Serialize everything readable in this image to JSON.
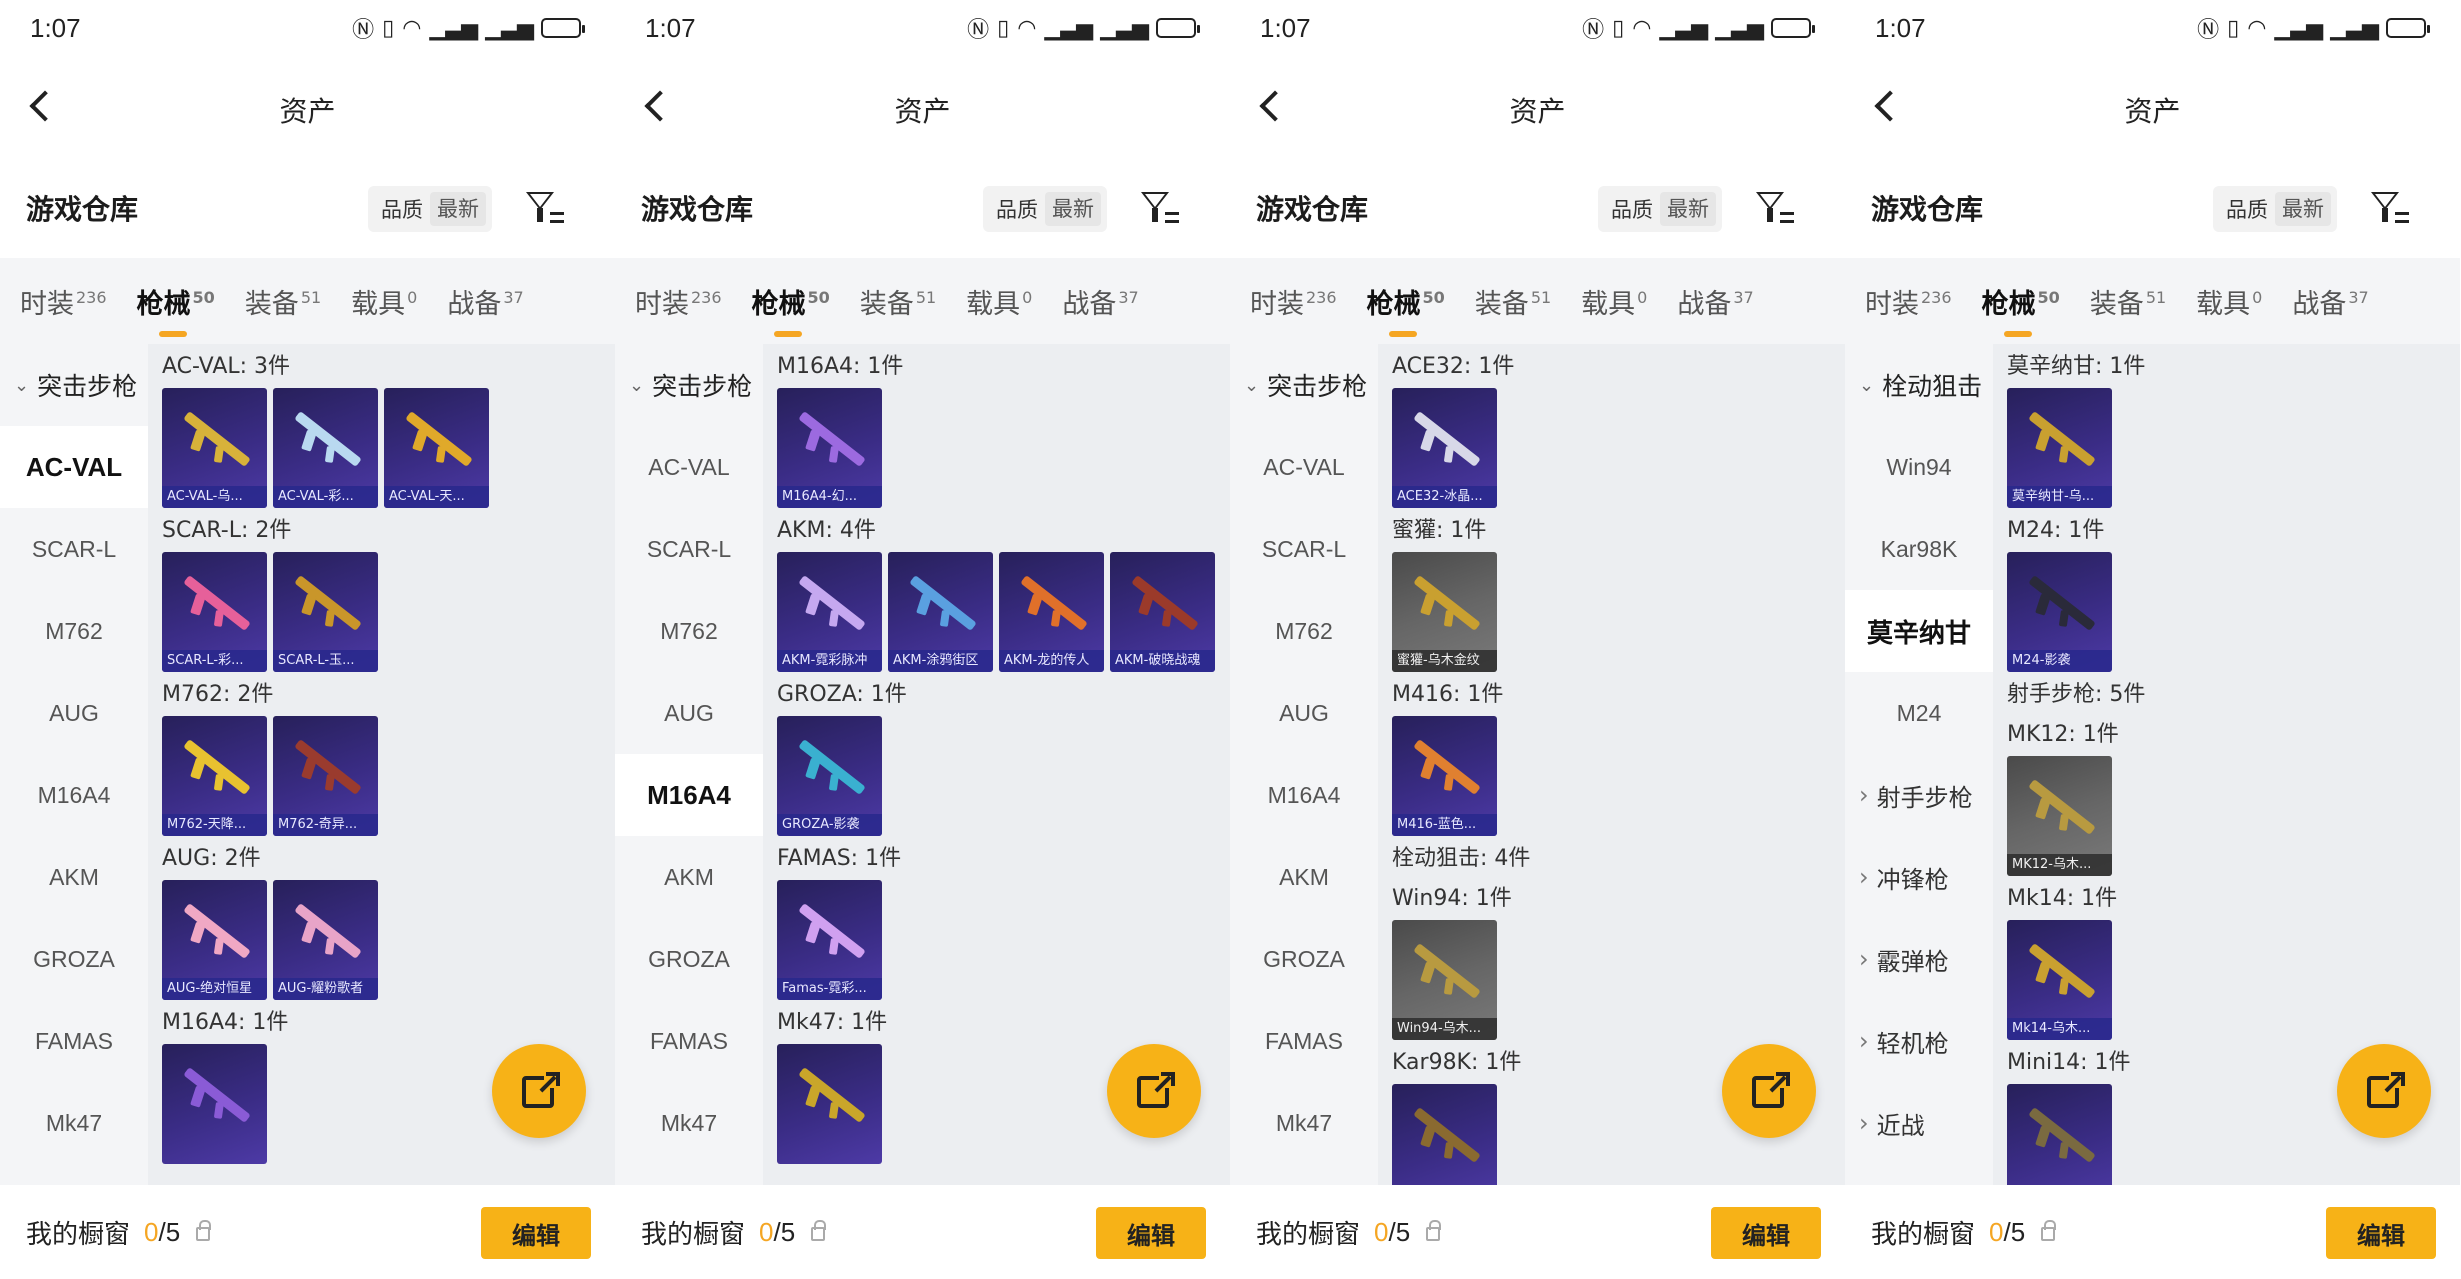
{
  "colors": {
    "accent": "#f7b217",
    "count_highlight": "#f5a623"
  },
  "screens": [
    {
      "status_time": "1:07",
      "title": "资产",
      "warehouse_title": "游戏仓库",
      "sort": {
        "quality": "品质",
        "latest": "最新"
      },
      "tabs": [
        {
          "label": "时装",
          "count": "236"
        },
        {
          "label": "枪械",
          "count": "50"
        },
        {
          "label": "装备",
          "count": "51"
        },
        {
          "label": "载具",
          "count": "0"
        },
        {
          "label": "战备",
          "count": "37"
        }
      ],
      "active_tab": 1,
      "sidebar": [
        {
          "label": "突击步枪",
          "type": "group"
        },
        {
          "label": "AC-VAL",
          "type": "item",
          "selected": true
        },
        {
          "label": "SCAR-L",
          "type": "item"
        },
        {
          "label": "M762",
          "type": "item"
        },
        {
          "label": "AUG",
          "type": "item"
        },
        {
          "label": "M16A4",
          "type": "item"
        },
        {
          "label": "AKM",
          "type": "item"
        },
        {
          "label": "GROZA",
          "type": "item"
        },
        {
          "label": "FAMAS",
          "type": "item"
        },
        {
          "label": "Mk47",
          "type": "item"
        }
      ],
      "sections": [
        {
          "title": "AC-VAL: 3件",
          "items": [
            {
              "label": "AC-VAL-乌...",
              "color": "#d8b23a"
            },
            {
              "label": "AC-VAL-彩...",
              "color": "#b9d9f0"
            },
            {
              "label": "AC-VAL-天...",
              "color": "#e0a92a"
            }
          ]
        },
        {
          "title": "SCAR-L: 2件",
          "items": [
            {
              "label": "SCAR-L-彩...",
              "color": "#e6609a"
            },
            {
              "label": "SCAR-L-玉...",
              "color": "#c9962a"
            }
          ]
        },
        {
          "title": "M762: 2件",
          "items": [
            {
              "label": "M762-天降...",
              "color": "#e8c230"
            },
            {
              "label": "M762-奇异...",
              "color": "#9a3b2e"
            }
          ]
        },
        {
          "title": "AUG: 2件",
          "items": [
            {
              "label": "AUG-绝对恒星",
              "color": "#f0a8c4"
            },
            {
              "label": "AUG-耀粉歌者",
              "color": "#e8a4c8"
            }
          ]
        },
        {
          "title": "M16A4: 1件",
          "items": [
            {
              "label": "",
              "color": "#8a5bd6"
            }
          ]
        }
      ]
    },
    {
      "status_time": "1:07",
      "title": "资产",
      "warehouse_title": "游戏仓库",
      "sort": {
        "quality": "品质",
        "latest": "最新"
      },
      "tabs": [
        {
          "label": "时装",
          "count": "236"
        },
        {
          "label": "枪械",
          "count": "50"
        },
        {
          "label": "装备",
          "count": "51"
        },
        {
          "label": "载具",
          "count": "0"
        },
        {
          "label": "战备",
          "count": "37"
        }
      ],
      "active_tab": 1,
      "sidebar": [
        {
          "label": "突击步枪",
          "type": "group"
        },
        {
          "label": "AC-VAL",
          "type": "item"
        },
        {
          "label": "SCAR-L",
          "type": "item"
        },
        {
          "label": "M762",
          "type": "item"
        },
        {
          "label": "AUG",
          "type": "item"
        },
        {
          "label": "M16A4",
          "type": "item",
          "selected": true
        },
        {
          "label": "AKM",
          "type": "item"
        },
        {
          "label": "GROZA",
          "type": "item"
        },
        {
          "label": "FAMAS",
          "type": "item"
        },
        {
          "label": "Mk47",
          "type": "item"
        }
      ],
      "sections": [
        {
          "title": "M16A4: 1件",
          "items": [
            {
              "label": "M16A4-幻...",
              "color": "#9c6ae0"
            }
          ]
        },
        {
          "title": "AKM: 4件",
          "items": [
            {
              "label": "AKM-霓彩脉冲",
              "color": "#c5a8f0"
            },
            {
              "label": "AKM-涂鸦街区",
              "color": "#5aa0e0"
            },
            {
              "label": "AKM-龙的传人",
              "color": "#e0702a"
            },
            {
              "label": "AKM-破晓战魂",
              "color": "#9b3a2a"
            }
          ]
        },
        {
          "title": "GROZA: 1件",
          "items": [
            {
              "label": "GROZA-影袭",
              "color": "#3ab0d0"
            }
          ]
        },
        {
          "title": "FAMAS: 1件",
          "items": [
            {
              "label": "Famas-霓彩...",
              "color": "#d0a0f0"
            }
          ]
        },
        {
          "title": "Mk47: 1件",
          "items": [
            {
              "label": "",
              "color": "#c9a62a"
            }
          ]
        }
      ]
    },
    {
      "status_time": "1:07",
      "title": "资产",
      "warehouse_title": "游戏仓库",
      "sort": {
        "quality": "品质",
        "latest": "最新"
      },
      "tabs": [
        {
          "label": "时装",
          "count": "236"
        },
        {
          "label": "枪械",
          "count": "50"
        },
        {
          "label": "装备",
          "count": "51"
        },
        {
          "label": "载具",
          "count": "0"
        },
        {
          "label": "战备",
          "count": "37"
        }
      ],
      "active_tab": 1,
      "sidebar": [
        {
          "label": "突击步枪",
          "type": "group"
        },
        {
          "label": "AC-VAL",
          "type": "item"
        },
        {
          "label": "SCAR-L",
          "type": "item"
        },
        {
          "label": "M762",
          "type": "item"
        },
        {
          "label": "AUG",
          "type": "item"
        },
        {
          "label": "M16A4",
          "type": "item"
        },
        {
          "label": "AKM",
          "type": "item"
        },
        {
          "label": "GROZA",
          "type": "item"
        },
        {
          "label": "FAMAS",
          "type": "item"
        },
        {
          "label": "Mk47",
          "type": "item"
        }
      ],
      "sections": [
        {
          "title": "ACE32: 1件",
          "items": [
            {
              "label": "ACE32-冰晶...",
              "color": "#d8d8e8"
            }
          ]
        },
        {
          "title": "蜜獾: 1件",
          "items": [
            {
              "label": "蜜獾-乌木金纹",
              "color": "#c9a030",
              "gray": true
            }
          ]
        },
        {
          "title": "M416: 1件",
          "items": [
            {
              "label": "M416-蓝色...",
              "color": "#e08030"
            }
          ]
        },
        {
          "title": "栓动狙击: 4件",
          "items": []
        },
        {
          "title": "Win94: 1件",
          "items": [
            {
              "label": "Win94-乌木...",
              "color": "#b89a40",
              "gray": true
            }
          ]
        },
        {
          "title": "Kar98K: 1件",
          "items": [
            {
              "label": "",
              "color": "#8a6a30"
            }
          ]
        }
      ]
    },
    {
      "status_time": "1:07",
      "title": "资产",
      "warehouse_title": "游戏仓库",
      "sort": {
        "quality": "品质",
        "latest": "最新"
      },
      "tabs": [
        {
          "label": "时装",
          "count": "236"
        },
        {
          "label": "枪械",
          "count": "50"
        },
        {
          "label": "装备",
          "count": "51"
        },
        {
          "label": "载具",
          "count": "0"
        },
        {
          "label": "战备",
          "count": "37"
        }
      ],
      "active_tab": 1,
      "sidebar": [
        {
          "label": "栓动狙击",
          "type": "group"
        },
        {
          "label": "Win94",
          "type": "item"
        },
        {
          "label": "Kar98K",
          "type": "item"
        },
        {
          "label": "莫辛纳甘",
          "type": "item",
          "selected": true
        },
        {
          "label": "M24",
          "type": "item"
        },
        {
          "label": "射手步枪",
          "type": "group2"
        },
        {
          "label": "冲锋枪",
          "type": "group2"
        },
        {
          "label": "霰弹枪",
          "type": "group2"
        },
        {
          "label": "轻机枪",
          "type": "group2"
        },
        {
          "label": "近战",
          "type": "group2"
        }
      ],
      "sections": [
        {
          "title": "莫辛纳甘: 1件",
          "items": [
            {
              "label": "莫辛纳甘-乌...",
              "color": "#c9a030"
            }
          ]
        },
        {
          "title": "M24: 1件",
          "items": [
            {
              "label": "M24-影袭",
              "color": "#2a2a3a"
            }
          ]
        },
        {
          "title": "射手步枪: 5件",
          "items": []
        },
        {
          "title": "MK12: 1件",
          "items": [
            {
              "label": "MK12-乌木...",
              "color": "#b89a40",
              "gray": true
            }
          ]
        },
        {
          "title": "Mk14: 1件",
          "items": [
            {
              "label": "Mk14-乌木...",
              "color": "#c9a030"
            }
          ]
        },
        {
          "title": "Mini14: 1件",
          "items": [
            {
              "label": "",
              "color": "#7a6a40"
            }
          ]
        }
      ]
    }
  ],
  "bottom": {
    "label": "我的橱窗",
    "count_current": "0",
    "count_total": "/5",
    "edit": "编辑"
  }
}
